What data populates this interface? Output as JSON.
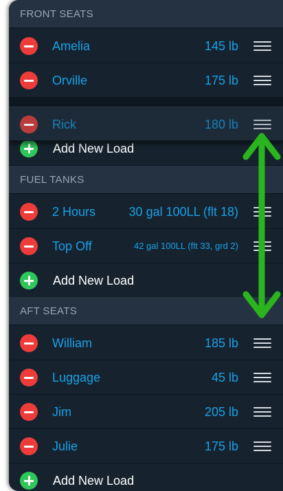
{
  "sections": {
    "front": {
      "header": "FRONT SEATS",
      "rows": [
        {
          "name": "Amelia",
          "weight": "145 lb"
        },
        {
          "name": "Orville",
          "weight": "175 lb"
        }
      ],
      "dragging": {
        "name": "Rick",
        "weight": "180 lb"
      },
      "add_label": "Add New Load"
    },
    "fuel": {
      "header": "FUEL TANKS",
      "rows": [
        {
          "name": "2 Hours",
          "weight": "30 gal 100LL (flt 18)"
        },
        {
          "name": "Top Off",
          "weight": "42 gal 100LL (flt 33, grd 2)"
        }
      ],
      "add_label": "Add New Load"
    },
    "aft": {
      "header": "AFT SEATS",
      "rows": [
        {
          "name": "William",
          "weight": "185 lb"
        },
        {
          "name": "Luggage",
          "weight": "45 lb"
        },
        {
          "name": "Jim",
          "weight": "205 lb"
        },
        {
          "name": "Julie",
          "weight": "175 lb"
        }
      ],
      "add_label": "Add New Load"
    }
  },
  "icons": {
    "delete": "minus-circle-icon",
    "add": "plus-circle-icon",
    "reorder": "reorder-handle-icon",
    "annotation": "double-headed-arrow-icon"
  },
  "colors": {
    "background": "#13202d",
    "header": "#243241",
    "accent_text": "#1aa0e6",
    "delete_red": "#ee3c3a",
    "add_green": "#2fc65a",
    "arrow_green": "#2ab51e"
  }
}
